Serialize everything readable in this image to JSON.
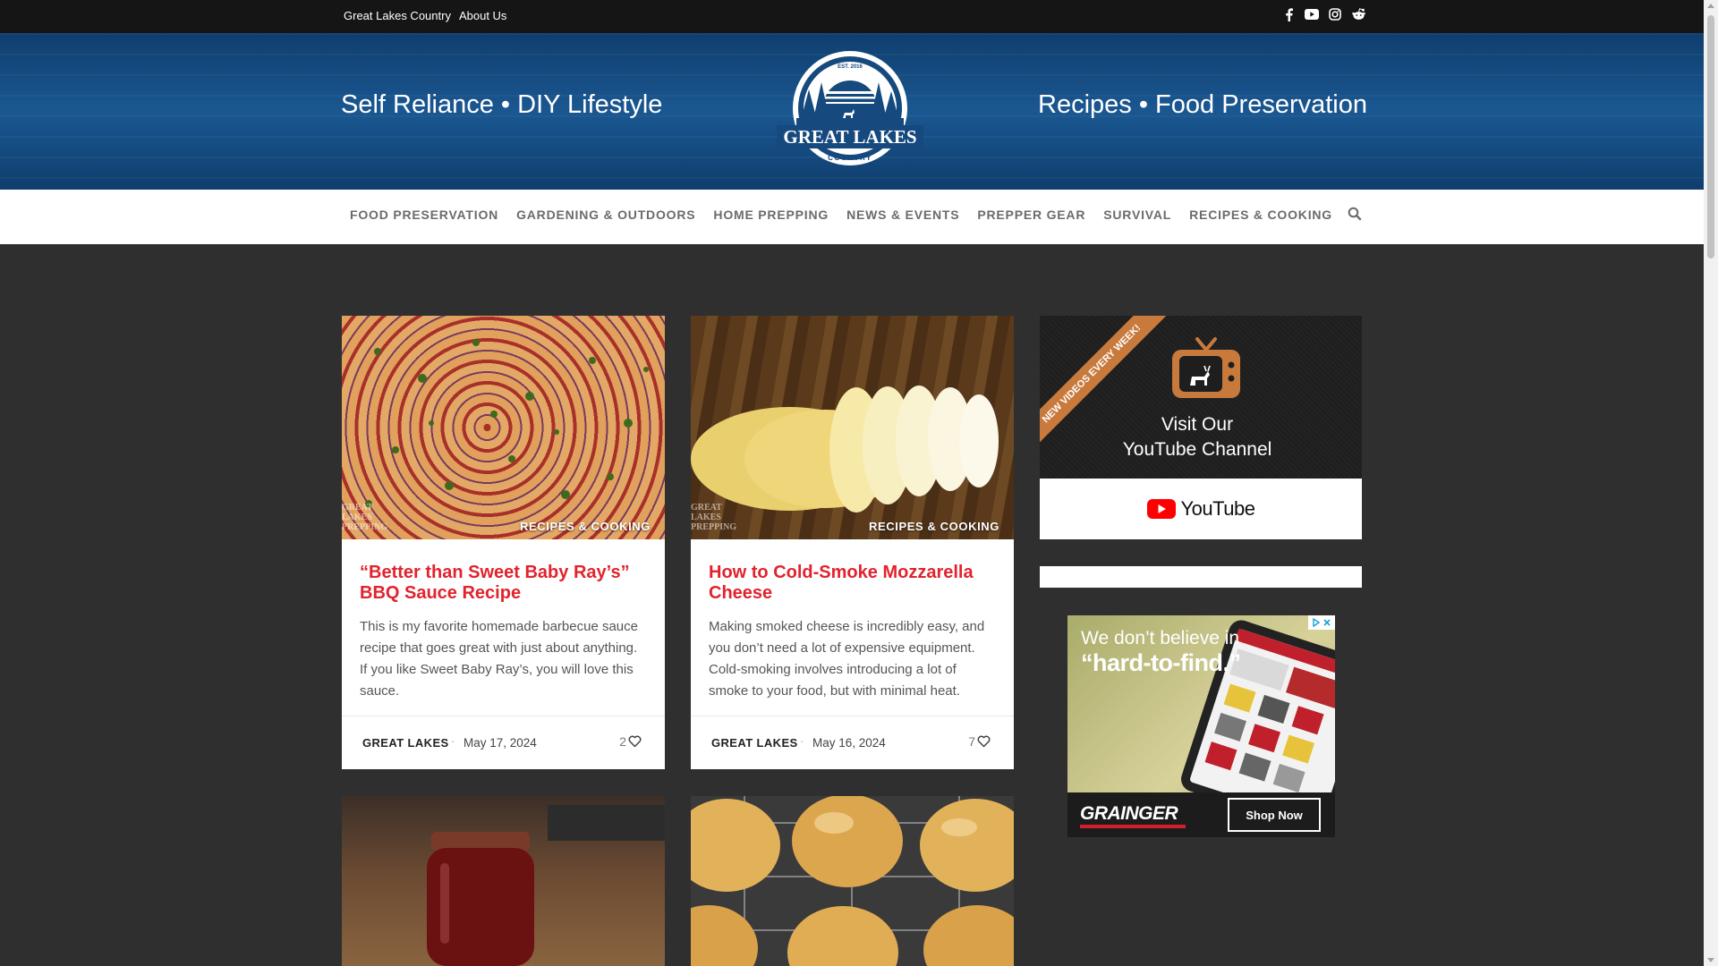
{
  "topbar": {
    "links": [
      "Great Lakes Country",
      "About Us"
    ],
    "social_icons": [
      "facebook-icon",
      "youtube-icon",
      "instagram-icon",
      "reddit-icon"
    ]
  },
  "header": {
    "tagline_left": "Self Reliance • DIY Lifestyle",
    "tagline_right": "Recipes • Food Preservation",
    "logo": {
      "est": "EST. 2016",
      "name": "GREAT LAKES",
      "sub": "COUNTRY"
    }
  },
  "nav": {
    "items": [
      "FOOD PRESERVATION",
      "GARDENING & OUTDOORS",
      "HOME PREPPING",
      "NEWS & EVENTS",
      "PREPPER GEAR",
      "SURVIVAL",
      "RECIPES & COOKING"
    ],
    "search_icon": "search-icon"
  },
  "posts": [
    {
      "category": "RECIPES & COOKING",
      "watermark": "GREAT LAKES PREPPING",
      "title": "“Better than Sweet Baby Ray’s” BBQ Sauce Recipe",
      "excerpt": "This is my favorite homemade barbecue sauce recipe that goes great with just about anything. If you like Sweet Baby Ray’s, you will love this sauce.",
      "author": "GREAT LAKES",
      "date": "May 17, 2024",
      "likes": "2"
    },
    {
      "category": "RECIPES & COOKING",
      "watermark": "GREAT LAKES PREPPING",
      "title": "How to Cold-Smoke Mozzarella Cheese",
      "excerpt": "Making smoked cheese is incredibly easy, and you don’t need a lot of expensive equipment. Cold-smoking involves introducing a lot of smoke to your food, but with minimal heat.",
      "author": "GREAT LAKES",
      "date": "May 16, 2024",
      "likes": "7"
    }
  ],
  "sidebar": {
    "youtube": {
      "ribbon": "NEW VIDEOS EVERY WEEK!",
      "visit_line1": "Visit Our",
      "visit_line2": "YouTube Channel",
      "wordmark": "YouTube"
    },
    "ad": {
      "headline1": "We don’t believe in",
      "headline2": "“hard-to-find.”",
      "brand": "GRAINGER",
      "cta": "Shop Now"
    }
  },
  "colors": {
    "accent_red": "#e2222d",
    "header_blue": "#1a5791",
    "page_bg": "#2f2f2f",
    "topbar_bg": "#151515"
  }
}
